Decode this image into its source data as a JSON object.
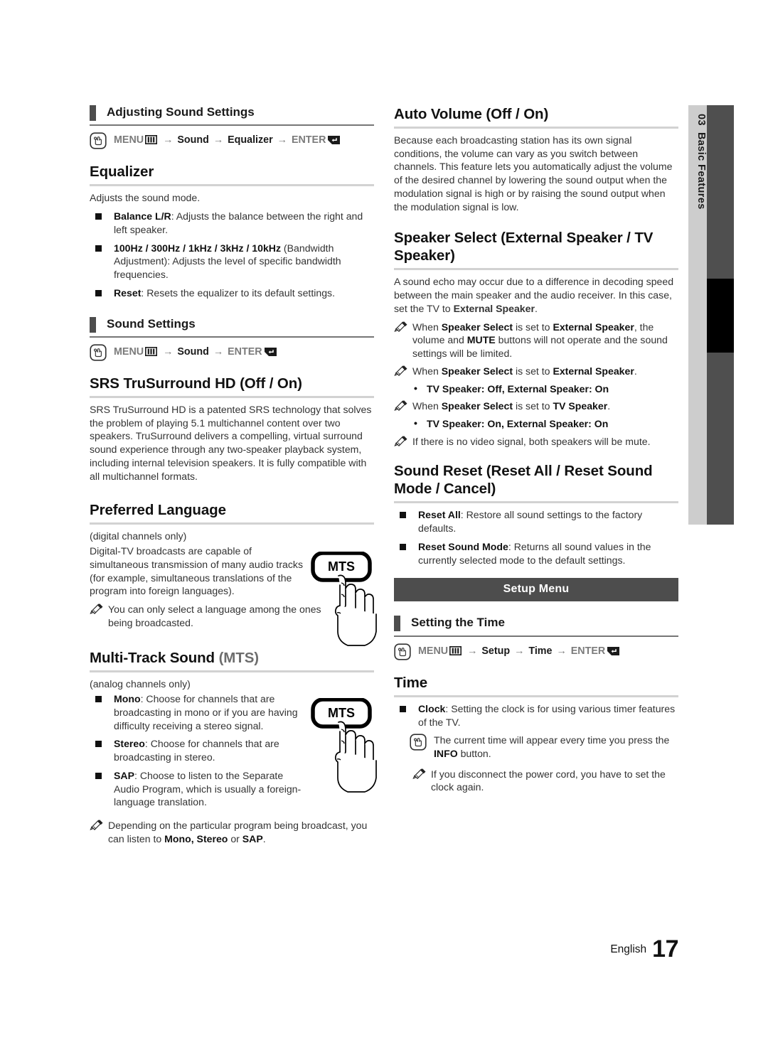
{
  "side_tab": {
    "chapter_number": "03",
    "chapter_title": "Basic Features"
  },
  "footer": {
    "language": "English",
    "page_number": "17"
  },
  "left_column": {
    "section_heading_1": "Adjusting Sound Settings",
    "menu_path_1": {
      "menu_label": "MENU",
      "arrow": "→",
      "step1": "Sound",
      "step2": "Equalizer",
      "enter_label": "ENTER"
    },
    "equalizer": {
      "title": "Equalizer",
      "intro": "Adjusts the sound mode.",
      "bullets": [
        {
          "term": "Balance L/R",
          "text": ": Adjusts the balance between the right and left speaker."
        },
        {
          "term": "100Hz / 300Hz / 1kHz / 3kHz / 10kHz",
          "text": " (Bandwidth Adjustment): Adjusts the level of specific bandwidth frequencies."
        },
        {
          "term": "Reset",
          "text": ": Resets the equalizer to its default settings."
        }
      ]
    },
    "section_heading_2": "Sound Settings",
    "menu_path_2": {
      "menu_label": "MENU",
      "arrow": "→",
      "step1": "Sound",
      "enter_label": "ENTER"
    },
    "srs": {
      "title": "SRS TruSurround HD (Off / On)",
      "body": "SRS TruSurround HD is a patented SRS technology that solves the problem of playing 5.1 multichannel content over two speakers. TruSurround delivers a compelling, virtual surround sound experience through any two-speaker playback system, including internal television speakers. It is fully compatible with all multichannel formats."
    },
    "preferred_language": {
      "title": "Preferred Language",
      "sub": "(digital channels only)",
      "body": "Digital-TV broadcasts are capable of simultaneous transmission of many audio tracks (for example, simultaneous translations of the program into foreign languages).",
      "note": "You can only select a language among the ones being broadcasted.",
      "remote_button_label": "MTS"
    },
    "mts": {
      "title_plain": "Multi-Track Sound ",
      "title_gray": "(MTS)",
      "sub": "(analog channels only)",
      "bullets": [
        {
          "term": "Mono",
          "text": ": Choose for channels that are broadcasting in mono or if you are having difficulty receiving a stereo signal."
        },
        {
          "term": "Stereo",
          "text": ": Choose for channels that are broadcasting in stereo."
        },
        {
          "term": "SAP",
          "text": ": Choose to listen to the Separate Audio Program, which is usually a foreign-language translation."
        }
      ],
      "note_part1": "Depending on the particular program being broadcast, you can listen to ",
      "note_bold1": "Mono, Stereo",
      "note_part2": " or ",
      "note_bold2": "SAP",
      "note_part3": ".",
      "remote_button_label": "MTS"
    }
  },
  "right_column": {
    "auto_volume": {
      "title": "Auto Volume (Off / On)",
      "body": "Because each broadcasting station has its own signal conditions, the volume can vary as you switch between channels. This feature lets you automatically adjust the volume of the desired channel by lowering the sound output when the modulation signal is high or by raising the sound output when the modulation signal is low."
    },
    "speaker_select": {
      "title": "Speaker Select (External Speaker / TV Speaker)",
      "body_part1": "A sound echo may occur due to a difference in decoding speed between the main speaker and the audio receiver. In this case, set the TV to ",
      "body_bold1": "External Speaker",
      "body_part2": ".",
      "note1_a": "When ",
      "note1_b": "Speaker Select",
      "note1_c": " is set to ",
      "note1_d": "External Speaker",
      "note1_e": ", the volume and ",
      "note1_f": "MUTE",
      "note1_g": " buttons will not operate and the sound settings will be limited.",
      "note2_a": "When ",
      "note2_b": "Speaker Select",
      "note2_c": " is set to ",
      "note2_d": "External Speaker",
      "note2_e": ".",
      "dot1": "TV Speaker: Off, External Speaker: On",
      "note3_a": "When ",
      "note3_b": "Speaker Select",
      "note3_c": " is set to ",
      "note3_d": "TV Speaker",
      "note3_e": ".",
      "dot2": "TV Speaker: On, External Speaker: On",
      "note4": "If there is no video signal, both speakers will be mute."
    },
    "sound_reset": {
      "title": "Sound Reset (Reset All / Reset Sound Mode / Cancel)",
      "bullets": [
        {
          "term": "Reset All",
          "text": ": Restore all sound settings to the factory defaults."
        },
        {
          "term": "Reset Sound Mode",
          "text": ": Returns all sound values in the currently selected mode to the default settings."
        }
      ]
    },
    "setup_banner": "Setup Menu",
    "section_heading_time": "Setting the Time",
    "menu_path_time": {
      "menu_label": "MENU",
      "arrow": "→",
      "step1": "Setup",
      "step2": "Time",
      "enter_label": "ENTER"
    },
    "time": {
      "title": "Time",
      "bullet_term": "Clock",
      "bullet_text": ": Setting the clock is for using various timer features of the TV.",
      "hand_note_part1": "The current time will appear every time you press the ",
      "hand_note_bold": "INFO",
      "hand_note_part2": " button.",
      "pencil_note": "If you disconnect the power cord, you have to set the clock again."
    }
  }
}
